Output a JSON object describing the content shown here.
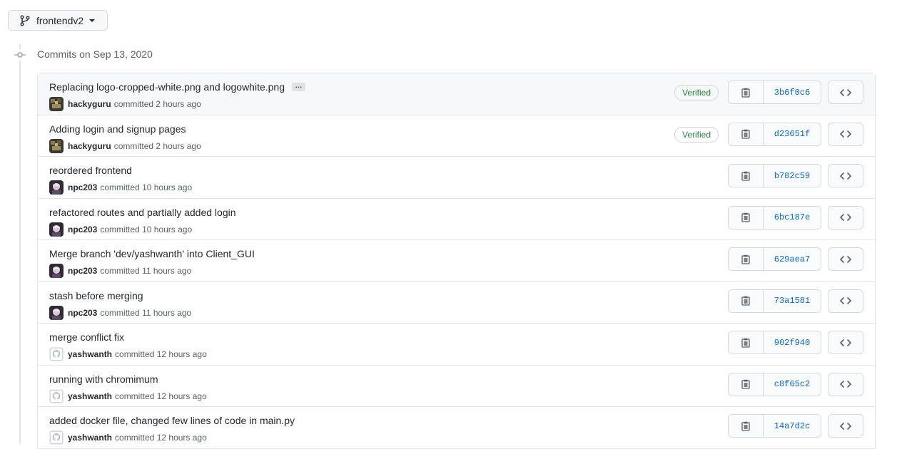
{
  "branch": {
    "name": "frontendv2"
  },
  "timeline": {
    "heading": "Commits on Sep 13, 2020"
  },
  "commits": [
    {
      "title": "Replacing logo-cropped-white.png and logowhite.png",
      "has_more": true,
      "more_label": "…",
      "author": "hackyguru",
      "action": "committed",
      "time": "2 hours ago",
      "verified": "Verified",
      "sha": "3b6f0c6",
      "avatar": "hackyguru"
    },
    {
      "title": "Adding login and signup pages",
      "has_more": false,
      "author": "hackyguru",
      "action": "committed",
      "time": "2 hours ago",
      "verified": "Verified",
      "sha": "d23651f",
      "avatar": "hackyguru"
    },
    {
      "title": "reordered frontend",
      "has_more": false,
      "author": "npc203",
      "action": "committed",
      "time": "10 hours ago",
      "verified": null,
      "sha": "b782c59",
      "avatar": "npc203"
    },
    {
      "title": "refactored routes and partially added login",
      "has_more": false,
      "author": "npc203",
      "action": "committed",
      "time": "10 hours ago",
      "verified": null,
      "sha": "6bc187e",
      "avatar": "npc203"
    },
    {
      "title": "Merge branch 'dev/yashwanth' into Client_GUI",
      "has_more": false,
      "author": "npc203",
      "action": "committed",
      "time": "11 hours ago",
      "verified": null,
      "sha": "629aea7",
      "avatar": "npc203"
    },
    {
      "title": "stash before merging",
      "has_more": false,
      "author": "npc203",
      "action": "committed",
      "time": "11 hours ago",
      "verified": null,
      "sha": "73a1581",
      "avatar": "npc203"
    },
    {
      "title": "merge conflict fix",
      "has_more": false,
      "author": "yashwanth",
      "action": "committed",
      "time": "12 hours ago",
      "verified": null,
      "sha": "902f940",
      "avatar": "default"
    },
    {
      "title": "running with chromimum",
      "has_more": false,
      "author": "yashwanth",
      "action": "committed",
      "time": "12 hours ago",
      "verified": null,
      "sha": "c8f65c2",
      "avatar": "default"
    },
    {
      "title": "added docker file, changed few lines of code in main.py",
      "has_more": false,
      "author": "yashwanth",
      "action": "committed",
      "time": "12 hours ago",
      "verified": null,
      "sha": "14a7d2c",
      "avatar": "default"
    }
  ],
  "colors": {
    "link": "#0366d6",
    "verified": "#22863a",
    "border": "#e1e4e8"
  },
  "icons": {
    "branch": "git-branch-icon",
    "copy": "clipboard-icon",
    "browse": "code-icon",
    "commit": "git-commit-icon"
  }
}
